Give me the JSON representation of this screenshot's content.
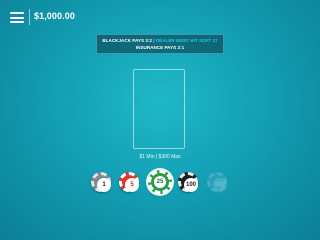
{
  "header": {
    "balance": "$1,000.00"
  },
  "rules": {
    "line1_main": "BLACKJACK PAYS 3:2",
    "line1_separator": "|",
    "line1_dim": "DEALER MUST HIT SOFT 17",
    "line2": "INSURANCE PAYS 2:1"
  },
  "table": {
    "limits": "$1 Min | $300 Max"
  },
  "chips": [
    {
      "value": "1"
    },
    {
      "value": "5"
    },
    {
      "value": "25",
      "selected": true
    },
    {
      "value": "100"
    },
    {
      "value": "500",
      "disabled": true
    }
  ],
  "colors": {
    "felt": "#139fb4",
    "chip_1": "#7a8a90",
    "chip_5": "#d93a2f",
    "chip_25": "#2f9c4a",
    "chip_100": "#1d1f24",
    "chip_500": "#3fa6c8"
  }
}
